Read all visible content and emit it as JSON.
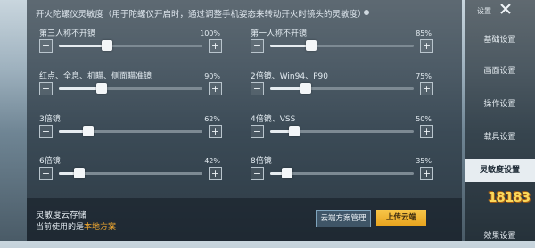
{
  "header": "开火陀螺仪灵敏度（用于陀螺仪开启时，通过调整手机姿态来转动开火时镜头的灵敏度）",
  "sliders": [
    {
      "label": "第三人称不开镜",
      "pct": "100%",
      "value": 100
    },
    {
      "label": "第一人称不开镜",
      "pct": "85%",
      "value": 85
    },
    {
      "label": "红点、全息、机瞄、侧面瞄准镜",
      "pct": "90%",
      "value": 90
    },
    {
      "label": "2倍镜、Win94、P90",
      "pct": "75%",
      "value": 75
    },
    {
      "label": "3倍镜",
      "pct": "62%",
      "value": 62
    },
    {
      "label": "4倍镜、VSS",
      "pct": "50%",
      "value": 50
    },
    {
      "label": "6倍镜",
      "pct": "42%",
      "value": 42
    },
    {
      "label": "8倍镜",
      "pct": "35%",
      "value": 35
    }
  ],
  "cloud": {
    "title": "灵敏度云存储",
    "current_prefix": "当前使用的是",
    "current_scheme": "本地方案",
    "manage_btn": "云端方案管理",
    "upload_btn": "上传云端"
  },
  "sidebar": {
    "top_label": "设置",
    "items": [
      "基础设置",
      "画面设置",
      "操作设置",
      "载具设置",
      "灵敏度设置",
      "效果设置"
    ],
    "active_index": 4
  },
  "watermark": "18183"
}
